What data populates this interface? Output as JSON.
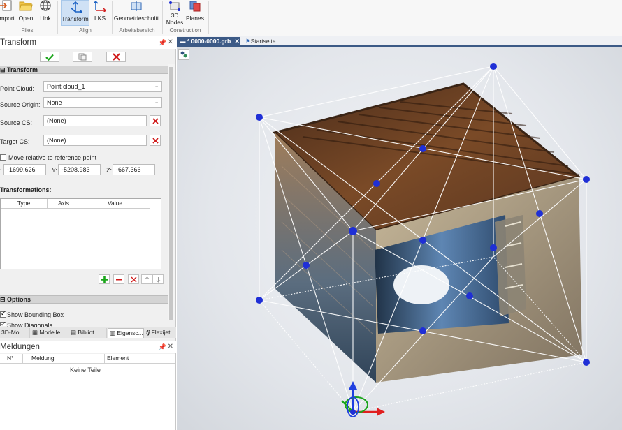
{
  "ribbon": {
    "buttons": {
      "import": "Import",
      "open": "Open",
      "link": "Link",
      "transform": "Transform",
      "lks": "LKS",
      "geometrieschnitt": "Geometrieschnitt",
      "nodes_line1": "3D",
      "nodes_line2": "Nodes",
      "planes": "Planes"
    },
    "groups": {
      "files": "Files",
      "align": "Align",
      "arbeitsbereich": "Arbeitsbereich",
      "construction": "Construction"
    }
  },
  "transform_panel": {
    "title": "Transform",
    "section_title": "Transform",
    "point_cloud_label": "Point Cloud:",
    "point_cloud_value": "Point cloud_1",
    "source_origin_label": "Source Origin:",
    "source_origin_value": "None",
    "source_cs_label": "Source CS:",
    "source_cs_value": "(None)",
    "target_cs_label": "Target CS:",
    "target_cs_value": "(None)",
    "move_relative_label": "Move relative to reference point",
    "x_label": ":",
    "x_value": "-1699.626",
    "y_label": "Y:",
    "y_value": "-5208.983",
    "z_label": "Z:",
    "z_value": "-667.366",
    "transformations_label": "Transformations:",
    "columns": [
      "Type",
      "Axis",
      "Value"
    ],
    "options_title": "Options",
    "show_bounding_box": "Show Bounding Box",
    "show_diagonals": "Show Diagonals"
  },
  "panel_tabs": [
    "3D-Mo...",
    "Modelle...",
    "Bibliot...",
    "Eigensc...",
    "Flexijet"
  ],
  "messages_panel": {
    "title": "Meldungen",
    "columns": [
      "N°",
      "Meldung",
      "Element"
    ],
    "empty_text": "Keine Teile"
  },
  "document_tabs": [
    "* 0000-0000.grb",
    "Startseite"
  ],
  "colors": {
    "accent": "#3c5a86",
    "handle": "#1f2fd6",
    "ok": "#1aa51a",
    "cancel": "#d01b1b"
  }
}
